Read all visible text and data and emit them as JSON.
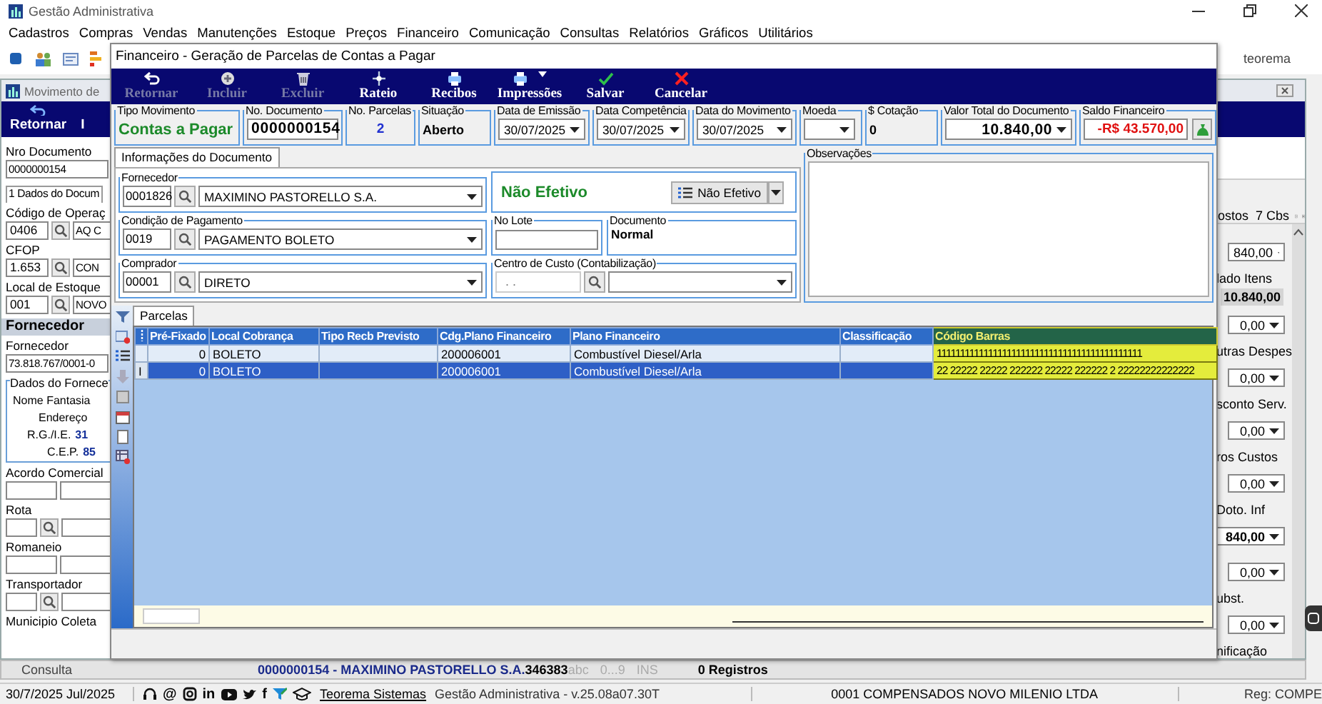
{
  "app": {
    "title": "Gestão Administrativa",
    "menu": [
      "Cadastros",
      "Compras",
      "Vendas",
      "Manutenções",
      "Estoque",
      "Preços",
      "Financeiro",
      "Comunicação",
      "Consultas",
      "Relatórios",
      "Gráficos",
      "Utilitários"
    ],
    "toolbar_label": "teorema"
  },
  "movement_window": {
    "title": "Movimento de",
    "toolbar": [
      "Retornar",
      "I"
    ],
    "left_panel": [
      {
        "kind": "label",
        "text": "Nro Documento"
      },
      {
        "kind": "field",
        "value": "0000000154"
      },
      {
        "kind": "tab",
        "text": "1 Dados do Docum"
      },
      {
        "kind": "label",
        "text": "Código de Operaç"
      },
      {
        "kind": "lookup",
        "code": "0406",
        "text": "AQ C"
      },
      {
        "kind": "label",
        "text": "CFOP"
      },
      {
        "kind": "lookup",
        "code": "1.653",
        "text": "CON"
      },
      {
        "kind": "label",
        "text": "Local de Estoque"
      },
      {
        "kind": "lookup",
        "code": "001",
        "text": "NOVO"
      },
      {
        "kind": "header",
        "text": "Fornecedor"
      },
      {
        "kind": "label",
        "text": "Fornecedor"
      },
      {
        "kind": "field",
        "value": "73.818.767/0001-0"
      },
      {
        "kind": "group",
        "text": "Dados do Fornece",
        "lines": [
          {
            "label": "Nome Fantasia"
          },
          {
            "label": "Endereço"
          },
          {
            "label": "R.G./I.E.",
            "value": "31"
          },
          {
            "label": "C.E.P.",
            "value": "85"
          }
        ]
      },
      {
        "kind": "label",
        "text": "Acordo Comercial"
      },
      {
        "kind": "blank"
      },
      {
        "kind": "label",
        "text": "Rota"
      },
      {
        "kind": "blank_lookup"
      },
      {
        "kind": "label",
        "text": "Romaneio"
      },
      {
        "kind": "blank"
      },
      {
        "kind": "label",
        "text": "Transportador"
      },
      {
        "kind": "blank_lookup"
      },
      {
        "kind": "label",
        "text": "Municipio Coleta"
      }
    ],
    "tabs": [
      "ostos",
      "7 Cbs"
    ],
    "right_panel": [
      {
        "kind": "amount",
        "value": "840,00"
      },
      {
        "kind": "label",
        "text": "lado Itens"
      },
      {
        "kind": "total",
        "value": "10.840,00"
      },
      {
        "kind": "amount",
        "value": "0,00"
      },
      {
        "kind": "label",
        "text": "utras Despes"
      },
      {
        "kind": "amount",
        "value": "0,00"
      },
      {
        "kind": "label",
        "text": "sconto Serv."
      },
      {
        "kind": "amount",
        "value": "0,00"
      },
      {
        "kind": "label",
        "text": "ros Custos"
      },
      {
        "kind": "amount",
        "value": "0,00"
      },
      {
        "kind": "label",
        "text": "Doto. Inf"
      },
      {
        "kind": "strong_amount",
        "value": "840,00"
      },
      {
        "kind": "amount",
        "value": "0,00"
      },
      {
        "kind": "label",
        "text": "ubst."
      },
      {
        "kind": "amount",
        "value": "0,00"
      },
      {
        "kind": "label",
        "text": "nificação"
      }
    ]
  },
  "dialog": {
    "title": "Financeiro - Geração de Parcelas de Contas a Pagar",
    "toolbar": [
      {
        "label": "Retornar",
        "disabled": true
      },
      {
        "label": "Incluir",
        "disabled": true
      },
      {
        "label": "Excluir",
        "disabled": true
      },
      {
        "label": "Rateio",
        "disabled": false
      },
      {
        "label": "Recibos",
        "disabled": false
      },
      {
        "label": "Impressões",
        "disabled": false
      },
      {
        "label": "Salvar",
        "disabled": false
      },
      {
        "label": "Cancelar",
        "disabled": false
      }
    ],
    "header_fields": [
      {
        "kind": "title",
        "label": "Tipo Movimento",
        "value": "Contas a Pagar"
      },
      {
        "kind": "input",
        "label": "No. Documento",
        "value": "0000000154"
      },
      {
        "kind": "count",
        "label": "No. Parcelas",
        "value": "2"
      },
      {
        "kind": "text",
        "label": "Situação",
        "value": "Aberto"
      },
      {
        "kind": "date",
        "label": "Data de Emissão",
        "value": "30/07/2025"
      },
      {
        "kind": "date",
        "label": "Data Competência",
        "value": "30/07/2025"
      },
      {
        "kind": "date",
        "label": "Data do Movimento",
        "value": "30/07/2025"
      },
      {
        "kind": "select",
        "label": "Moeda"
      },
      {
        "kind": "text",
        "label": "$ Cotação",
        "value": "0"
      },
      {
        "kind": "amount",
        "label": "Valor Total do Documento",
        "value": "10.840,00"
      },
      {
        "kind": "balance",
        "label": "Saldo Financeiro",
        "value": "-R$ 43.570,00"
      }
    ],
    "info_tab": {
      "label": "Informações do Documento",
      "selected": true
    },
    "supplier": {
      "label": "Fornecedor",
      "code": "0001826",
      "name": "MAXIMINO PASTORELLO S.A."
    },
    "status": {
      "text": "Não Efetivo",
      "button": "Não Efetivo"
    },
    "payment": {
      "label": "Condição de Pagamento",
      "code": "0019",
      "name": "PAGAMENTO BOLETO"
    },
    "lot": {
      "label": "No Lote"
    },
    "document": {
      "label": "Documento",
      "value": "Normal"
    },
    "buyer": {
      "label": "Comprador",
      "code": "00001",
      "name": "DIRETO"
    },
    "cost_center": {
      "label": "Centro de Custo (Contabilização)",
      "code": ".  ."
    },
    "notes": {
      "label": "Observações"
    },
    "parcelas_tab": {
      "label": "Parcelas",
      "selected": true
    },
    "table": {
      "columns": [
        "Pré-Fixado",
        "Local Cobrança",
        "Tipo Recb Previsto",
        "Cdg.Plano Financeiro",
        "Plano Financeiro",
        "Classificação",
        "Código Barras"
      ],
      "rows": [
        {
          "selected": false,
          "cells": [
            "0",
            "BOLETO",
            "",
            "200006001",
            "Combustível Diesel/Arla",
            "",
            "11111111111111111111111111111111111111111111"
          ]
        },
        {
          "selected": true,
          "indicator": "I",
          "cells": [
            "0",
            "BOLETO",
            "",
            "200006001",
            "Combustível Diesel/Arla",
            "",
            "22 22222 22222 222222 22222 222222 2 22222222222222"
          ]
        }
      ]
    }
  },
  "nav_bar": {
    "mode": "Consulta",
    "record": "0000000154 - MAXIMINO PASTORELLO S.A.",
    "code": "346383",
    "indicators": [
      "abc",
      "0...9",
      "INS"
    ],
    "count": "0 Registros"
  },
  "status_bar": {
    "date": "30/7/2025 Jul/2025",
    "social": [
      {
        "kind": "headset"
      },
      {
        "kind": "glyph",
        "text": "@"
      },
      {
        "kind": "camera"
      },
      {
        "kind": "glyph",
        "text": "in"
      },
      {
        "kind": "play"
      },
      {
        "kind": "bird"
      },
      {
        "kind": "glyph",
        "text": "f"
      },
      {
        "kind": "funnel"
      },
      {
        "kind": "cap"
      }
    ],
    "link": "Teorema Sistemas",
    "version": "Gestão Administrativa - v.25.08a07.30T",
    "company": "0001 COMPENSADOS NOVO MILENIO LTDA",
    "region": "Reg: COMPE"
  }
}
